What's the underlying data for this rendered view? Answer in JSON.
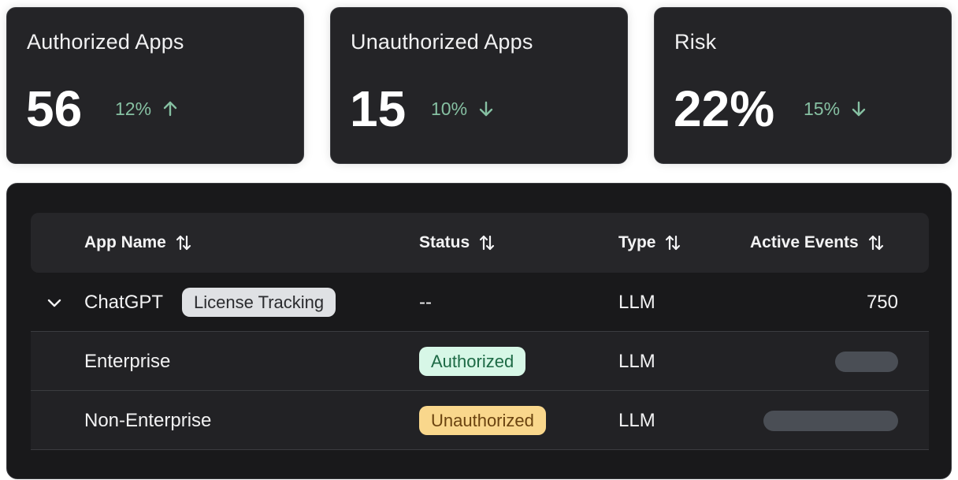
{
  "stats": [
    {
      "title": "Authorized Apps",
      "value": "56",
      "delta": "12%",
      "trend": "up",
      "icon": "arrow-up-icon"
    },
    {
      "title": "Unauthorized Apps",
      "value": "15",
      "delta": "10%",
      "trend": "down",
      "icon": "arrow-down-icon"
    },
    {
      "title": "Risk",
      "value": "22%",
      "delta": "15%",
      "trend": "down",
      "icon": "arrow-down-icon"
    }
  ],
  "table": {
    "columns": [
      {
        "label": "App Name",
        "icon": "sort-icon"
      },
      {
        "label": "Status",
        "icon": "sort-icon"
      },
      {
        "label": "Type",
        "icon": "sort-icon"
      },
      {
        "label": "Active Events",
        "icon": "sort-icon"
      }
    ],
    "rows": [
      {
        "name": "ChatGPT",
        "tag": "License Tracking",
        "status": "--",
        "type": "LLM",
        "events": "750",
        "expanded": true
      },
      {
        "name": "Enterprise",
        "status": "Authorized",
        "type": "LLM",
        "events_bar_fraction": 0.47
      },
      {
        "name": "Non-Enterprise",
        "status": "Unauthorized",
        "type": "LLM",
        "events_bar_fraction": 1.0
      }
    ]
  },
  "colors": {
    "card_bg": "#242427",
    "panel_bg": "#19191b",
    "delta_green": "#86c0a2",
    "authorized_bg": "#d7f7e7",
    "unauthorized_bg": "#f9d78c",
    "license_bg": "#dfe1e4",
    "bar_color": "#4a4e55"
  }
}
